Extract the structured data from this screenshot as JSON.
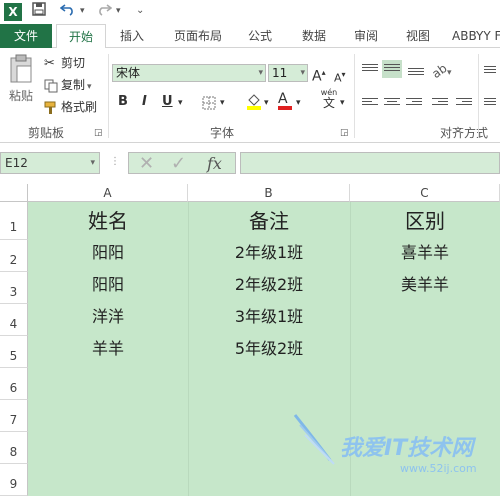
{
  "qat": {
    "app_icon": "X",
    "save_icon": "save-icon",
    "undo_icon": "undo-icon",
    "redo_icon": "redo-icon"
  },
  "tabs": [
    "文件",
    "开始",
    "插入",
    "页面布局",
    "公式",
    "数据",
    "审阅",
    "视图",
    "ABBYY F"
  ],
  "ribbon": {
    "clipboard": {
      "paste": "粘贴",
      "cut": "剪切",
      "copy": "复制",
      "format_painter": "格式刷",
      "label": "剪贴板"
    },
    "font": {
      "name": "宋体",
      "size": "11",
      "bold": "B",
      "italic": "I",
      "underline": "U",
      "wen": "wén",
      "wen2": "文",
      "grow": "A",
      "shrink": "A",
      "fill": "A",
      "label": "字体"
    },
    "alignment": {
      "label": "对齐方式"
    }
  },
  "formula_bar": {
    "name_box": "E12",
    "fx": "fx",
    "formula": ""
  },
  "columns": [
    "A",
    "B",
    "C"
  ],
  "rows": [
    "1",
    "2",
    "3",
    "4",
    "5",
    "6",
    "7",
    "8",
    "9"
  ],
  "sheet": {
    "row1": [
      "姓名",
      "备注",
      "区别"
    ],
    "row2": [
      "阳阳",
      "2年级1班",
      "喜羊羊"
    ],
    "row3": [
      "阳阳",
      "2年级2班",
      "美羊羊"
    ],
    "row4": [
      "洋洋",
      "3年级1班",
      ""
    ],
    "row5": [
      "羊羊",
      "5年级2班",
      ""
    ]
  },
  "watermark": {
    "title": "我爱IT技术网",
    "url": "www.52ij.com"
  },
  "colors": {
    "excel_green": "#217346",
    "cell_fill": "#c6e7ca",
    "field_fill": "#d5ecd7"
  }
}
